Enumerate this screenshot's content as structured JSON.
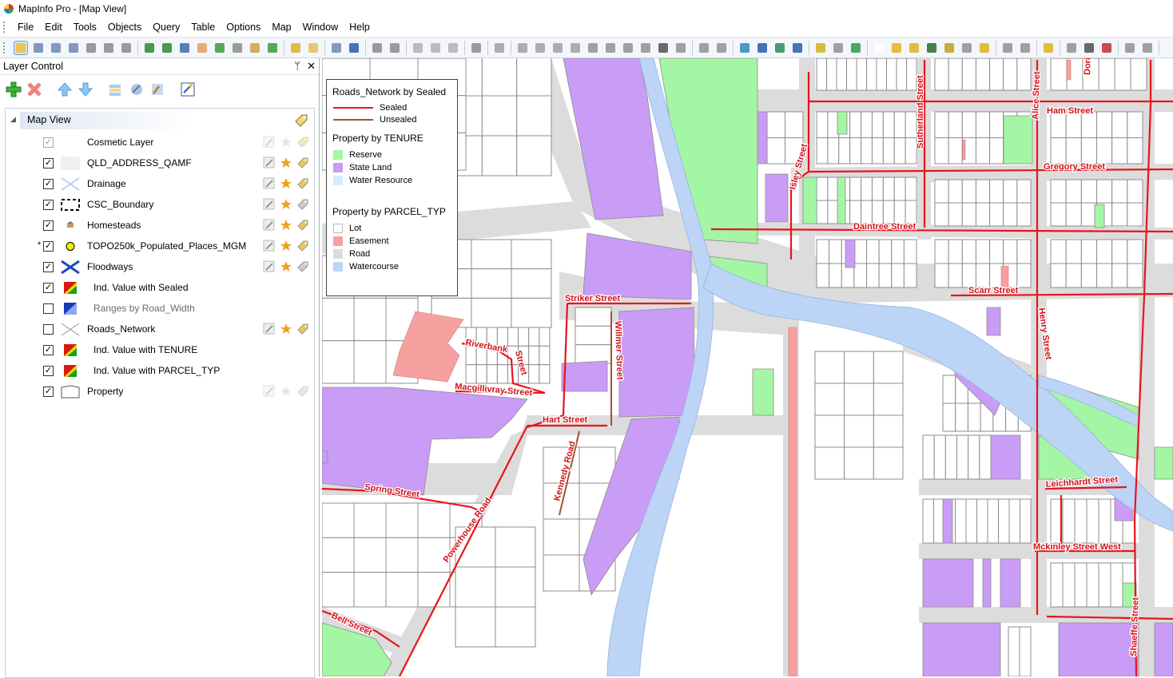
{
  "window": {
    "title": "MapInfo Pro - [Map View]"
  },
  "menu": [
    "File",
    "Edit",
    "Tools",
    "Objects",
    "Query",
    "Table",
    "Options",
    "Map",
    "Window",
    "Help"
  ],
  "layer_control": {
    "title": "Layer Control",
    "pin": "ᛘ",
    "close": "✕",
    "root": "Map View",
    "layers": [
      {
        "name": "Cosmetic Layer",
        "checked": true,
        "grey": true,
        "sub": false,
        "dim": false,
        "star": ""
      },
      {
        "name": "QLD_ADDRESS_QAMF",
        "checked": true,
        "grey": false,
        "sub": false,
        "dim": false,
        "star": ""
      },
      {
        "name": "Drainage",
        "checked": true,
        "grey": false,
        "sub": false,
        "dim": false,
        "star": ""
      },
      {
        "name": "CSC_Boundary",
        "checked": true,
        "grey": false,
        "sub": false,
        "dim": false,
        "star": ""
      },
      {
        "name": "Homesteads",
        "checked": true,
        "grey": false,
        "sub": false,
        "dim": false,
        "star": ""
      },
      {
        "name": "TOPO250k_Populated_Places_MGM",
        "checked": true,
        "grey": false,
        "sub": false,
        "dim": false,
        "star": "*"
      },
      {
        "name": "Floodways",
        "checked": true,
        "grey": false,
        "sub": false,
        "dim": false,
        "star": ""
      },
      {
        "name": "Ind. Value with Sealed",
        "checked": true,
        "grey": false,
        "sub": true,
        "dim": false,
        "star": ""
      },
      {
        "name": "Ranges by Road_Width",
        "checked": false,
        "grey": false,
        "sub": true,
        "dim": true,
        "star": ""
      },
      {
        "name": "Roads_Network",
        "checked": false,
        "grey": false,
        "sub": false,
        "dim": false,
        "star": ""
      },
      {
        "name": "Ind. Value with TENURE",
        "checked": true,
        "grey": false,
        "sub": true,
        "dim": false,
        "star": ""
      },
      {
        "name": "Ind. Value with PARCEL_TYP",
        "checked": true,
        "grey": false,
        "sub": true,
        "dim": false,
        "star": ""
      },
      {
        "name": "Property",
        "checked": true,
        "grey": false,
        "sub": false,
        "dim": false,
        "star": ""
      }
    ]
  },
  "legend": {
    "roads_title": "Roads_Network by Sealed",
    "sealed": "Sealed",
    "unsealed": "Unsealed",
    "tenure_title": "Property by TENURE",
    "reserve": "Reserve",
    "state_land": "State Land",
    "water_resource": "Water Resource",
    "parcel_title": "Property by PARCEL_TYP",
    "lot": "Lot",
    "easement": "Easement",
    "road": "Road",
    "watercourse": "Watercourse"
  },
  "streets": {
    "ham": "Ham Street",
    "gregory": "Gregory Street",
    "daintree": "Daintree Street",
    "scarr": "Scarr Street",
    "striker": "Striker Street",
    "riverbank": "Riverbank",
    "street_riv": "Street",
    "macgillivray": "Macgillivray Street",
    "hart": "Hart Street",
    "spring": "Spring Street",
    "powerhouse": "Powerhouse Road",
    "kennedy": "Kennedy Road",
    "willmer": "Willmer Street",
    "leichhardt": "Leichhardt Street",
    "mckinley": "Mckinley Street West",
    "bell": "Bell Street",
    "henry": "Henry Street",
    "alice": "Alice Street",
    "sutherland": "Sutherland Street",
    "isley": "Isley Street",
    "shaeffe": "Shaeffe Street",
    "dor": "Dori"
  },
  "colors": {
    "sealed": "#e8141c",
    "unsealed": "#a0522d",
    "reserve": "#a4f6a4",
    "state_land": "#c99cf6",
    "water_resource": "#d4ecff",
    "easement": "#f6a0a0",
    "road": "#dcdcdc",
    "watercourse": "#bcd4f6",
    "lot": "#ffffff"
  }
}
